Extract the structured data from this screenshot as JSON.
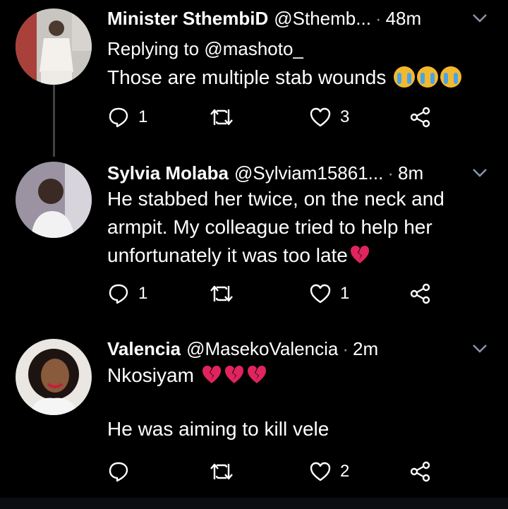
{
  "tweets": [
    {
      "name": "Minister SthembiD",
      "handle": "@Sthemb...",
      "time": "48m",
      "reply_prefix": "Replying to",
      "reply_to": "@mashoto_",
      "text": "Those are multiple stab wounds",
      "emojis": [
        "loudly-crying-face",
        "loudly-crying-face",
        "loudly-crying-face"
      ],
      "replies": "1",
      "retweets": "",
      "likes": "3"
    },
    {
      "name": "Sylvia Molaba",
      "handle": "@Sylviam15861...",
      "time": "8m",
      "text_lines": [
        "He stabbed her twice, on the neck and",
        "armpit. My colleague tried to help her",
        "unfortunately it was too late"
      ],
      "emojis": [
        "broken-heart"
      ],
      "replies": "1",
      "retweets": "",
      "likes": "1"
    },
    {
      "name": "Valencia",
      "handle": "@MasekoValencia",
      "time": "2m",
      "text_line1": "Nkosiyam",
      "emojis": [
        "broken-heart",
        "broken-heart",
        "broken-heart"
      ],
      "text_line2": "He was aiming to kill vele",
      "replies": "",
      "retweets": "",
      "likes": "2"
    }
  ],
  "colors": {
    "background": "#000000",
    "muted": "#8b98a5",
    "thread_line": "#3d4247",
    "broken_heart": "#e0245e"
  }
}
